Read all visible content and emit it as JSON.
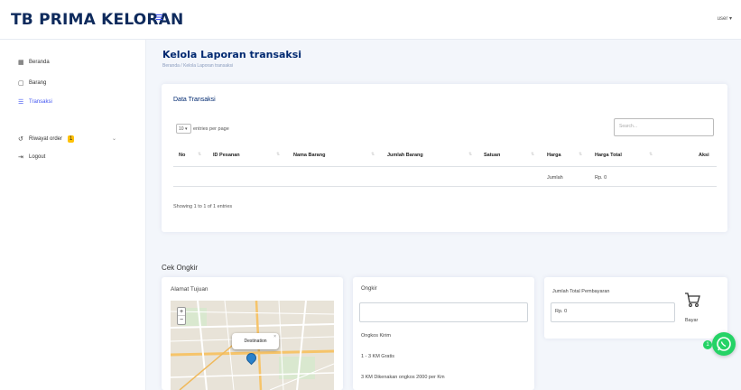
{
  "app": {
    "brand": "TB PRIMA KELORAN",
    "menu_glyph": "≡",
    "user_menu": "user ▾"
  },
  "sidebar": {
    "items": [
      {
        "label": "Beranda",
        "icon": "grid-icon"
      },
      {
        "label": "Barang",
        "icon": "box-icon"
      },
      {
        "label": "Transaksi",
        "icon": "receipt-icon"
      },
      {
        "label": "Riwayat order",
        "icon": "history-icon",
        "badge": "1"
      },
      {
        "label": "Logout",
        "icon": "logout-icon"
      }
    ]
  },
  "page": {
    "title": "Kelola Laporan transaksi",
    "breadcrumb": "Beranda / Kelola Laporan transaksi"
  },
  "transaksi_card": {
    "title": "Data Transaksi",
    "entries_value": "10",
    "entries_label": "entries per page",
    "search_placeholder": "Search...",
    "columns": [
      "No",
      "ID Pesanan",
      "Nama Barang",
      "Jumlah Barang",
      "Satuan",
      "Harga",
      "Harga Total",
      "Aksi"
    ],
    "row": {
      "harga": "Jumlah",
      "harga_total": "Rp. 0"
    },
    "showing": "Showing 1 to 1 of 1 entries"
  },
  "cek_ongkir": {
    "title": "Cek Ongkir",
    "alamat": {
      "label": "Alamat Tujuan",
      "popup": "Destination",
      "zoom_in": "+",
      "zoom_out": "−"
    },
    "ongkir": {
      "label": "Ongkir",
      "ongkos_label": "Ongkos Kirim",
      "line1": "1 - 3 KM Gratis",
      "line2": "3 KM Dikenakan ongkos 2000 per Km"
    },
    "pembayaran": {
      "label": "Jumlah Total Pembayaran",
      "value": "Rp. 0",
      "bayar": "Bayar"
    }
  },
  "whatsapp": {
    "badge": "1"
  },
  "colors": {
    "primary": "#4154f1",
    "title": "#012970",
    "whatsapp": "#25d366"
  }
}
